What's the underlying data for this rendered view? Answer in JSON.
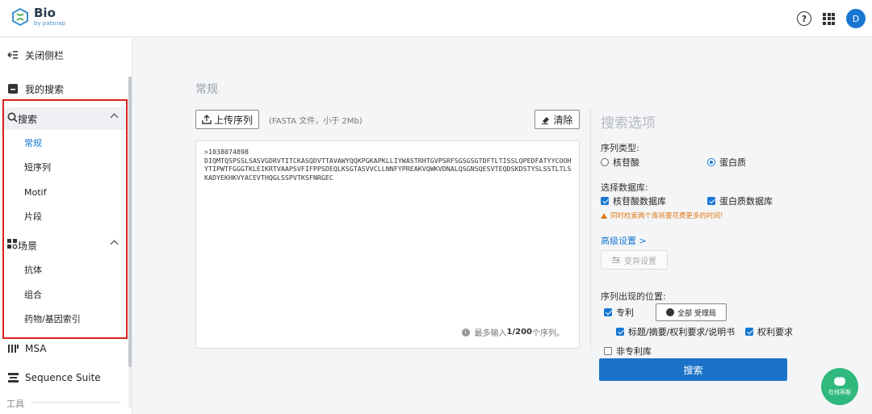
{
  "app": {
    "logo_title": "Bio",
    "logo_sub": "by patsnap",
    "avatar_letter": "D",
    "help_symbol": "?"
  },
  "sidebar": {
    "close_label": "关闭侧栏",
    "my_search": "我的搜索",
    "search_section": "搜索",
    "search_items": [
      "常规",
      "短序列",
      "Motif",
      "片段"
    ],
    "scene_section": "场景",
    "scene_items": [
      "抗体",
      "组合",
      "药物/基因索引"
    ],
    "msa": "MSA",
    "sequence_suite": "Sequence Suite",
    "tools": "工具",
    "active_item": "常规"
  },
  "main": {
    "title": "常规",
    "upload_label": "上传序列",
    "upload_hint": "(FASTA 文件，小于 2Mb)",
    "clear_label": "清除",
    "sequence_text": ">1038074898\nDIQMTQSPSSLSASVGDRVTITCKASQDVTTAVAWYQQKPGKAPKLLIYWASTRHTGVPSRFSGSGSGTDFTLTISSLQPEDFATYYCOOHYTIPWTFGGGTKLEIKRTVAAPSVFIFPPSDEQLKSGTASVVCLLNNFYPREAKVQWKVDNALQSGNSQESVTEQDSKDSTYSLSSTLTLSKADYEKHKVYACEVTHQGLSSPVTKSFNRGEC",
    "max_hint_prefix": "最多输入",
    "max_hint_bold": "1/200",
    "max_hint_suffix": "个序列。"
  },
  "options": {
    "title": "搜索选项",
    "seq_type_label": "序列类型:",
    "seq_types": [
      "核苷酸",
      "蛋白质"
    ],
    "seq_type_selected": "蛋白质",
    "db_label": "选择数据库:",
    "dbs": [
      "核苷酸数据库",
      "蛋白质数据库"
    ],
    "warning": "同时检索两个库将要花费更多的时间!",
    "advanced_link": "高级设置 >",
    "mutation_btn": "变异设置",
    "position_label": "序列出现的位置:",
    "patent": "专利",
    "office_btn": "全部 受理局",
    "title_abstract": "标题/摘要/权利要求/说明书",
    "claims": "权利要求",
    "non_patent": "非专利库",
    "search_btn": "搜索"
  },
  "chat": {
    "label": "在线客服"
  },
  "colors": {
    "accent": "#1677d2",
    "button": "#1a73c8",
    "highlight_box": "#d9221c",
    "chat": "#2fb97d",
    "warning": "#e07a18"
  }
}
